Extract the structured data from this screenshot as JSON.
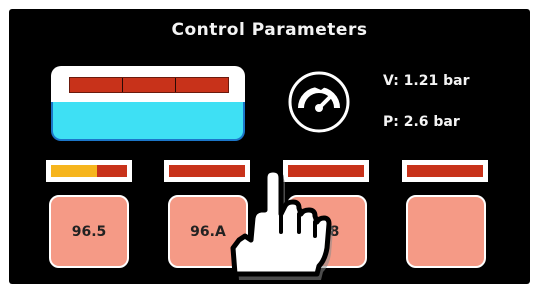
{
  "header": {
    "title": "Control Parameters"
  },
  "tank": {
    "level_label": "tank-level"
  },
  "gauge": {
    "icon": "pressure-gauge-icon"
  },
  "readouts": {
    "v": "V: 1.21 bar",
    "p": "P: 2.6 bar"
  },
  "channels": [
    {
      "value": "96.5",
      "bar_fill_fraction": 0.6
    },
    {
      "value": "96.A",
      "bar_fill_fraction": 0.0
    },
    {
      "value": "6.8",
      "bar_fill_fraction": 0.0
    },
    {
      "value": "",
      "bar_fill_fraction": 0.0
    }
  ],
  "colors": {
    "accent_red": "#c8321a",
    "accent_yellow": "#f6b51d",
    "tank_liquid": "#3ee0f4",
    "button_fill": "#f59a86"
  },
  "overlay": {
    "icon": "pointing-hand-cursor-icon"
  }
}
